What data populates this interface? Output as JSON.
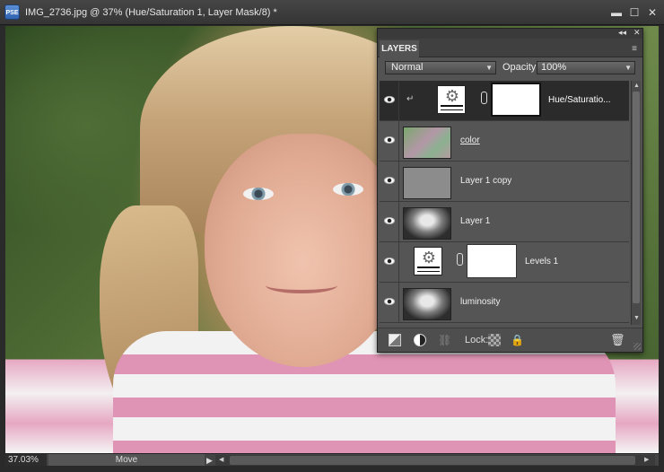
{
  "window": {
    "app_icon_label": "PSE",
    "title": "IMG_2736.jpg @ 37% (Hue/Saturation 1, Layer Mask/8) *",
    "minimize_glyph": "▬",
    "maximize_glyph": "☐",
    "close_glyph": "✕"
  },
  "layers_panel": {
    "collapse_glyph": "◂◂",
    "close_glyph": "✕",
    "tab_label": "LAYERS",
    "menu_glyph": "≡",
    "blend_mode": "Normal",
    "dropdown_glyph": "▼",
    "opacity_label": "Opacity:",
    "opacity_value": "100%",
    "layers": [
      {
        "name": "Hue/Saturatio...",
        "type": "adjustment",
        "selected": true,
        "visible": true
      },
      {
        "name": "color",
        "type": "pixel",
        "selected": false,
        "visible": true
      },
      {
        "name": "Layer 1 copy",
        "type": "pixel",
        "selected": false,
        "visible": true
      },
      {
        "name": "Layer 1",
        "type": "pixel",
        "selected": false,
        "visible": true
      },
      {
        "name": "Levels 1",
        "type": "adjustment",
        "selected": false,
        "visible": true
      },
      {
        "name": "luminosity",
        "type": "pixel",
        "selected": false,
        "visible": true
      }
    ],
    "bottom": {
      "lock_label": "Lock:",
      "trash_glyph": "🗑"
    }
  },
  "status_bar": {
    "zoom": "37.03%",
    "tool_info": "Move",
    "arrow_glyph": "▶"
  },
  "colors": {
    "selected_layer": "#2b2b2b",
    "panel_bg": "#535353",
    "app_bg": "#2a2a2a"
  }
}
